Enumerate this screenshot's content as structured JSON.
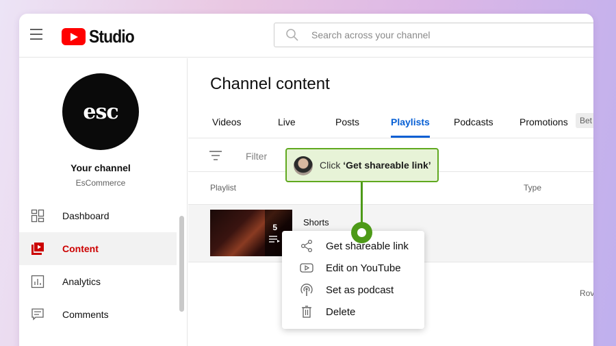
{
  "header": {
    "logo_text": "Studio",
    "search_placeholder": "Search across your channel"
  },
  "sidebar": {
    "avatar_text": "esc",
    "channel_title": "Your channel",
    "channel_handle": "EsCommerce",
    "items": [
      {
        "label": "Dashboard",
        "icon": "dashboard-icon"
      },
      {
        "label": "Content",
        "icon": "content-icon",
        "active": true
      },
      {
        "label": "Analytics",
        "icon": "analytics-icon"
      },
      {
        "label": "Comments",
        "icon": "comments-icon"
      }
    ]
  },
  "main": {
    "title": "Channel content",
    "tabs": [
      "Videos",
      "Live",
      "Posts",
      "Playlists",
      "Podcasts",
      "Promotions"
    ],
    "active_tab": "Playlists",
    "tab_badge": "Bet",
    "filter_label": "Filter",
    "columns": [
      "Playlist",
      "Type"
    ],
    "rows": [
      {
        "title": "Shorts",
        "video_count": "5"
      }
    ],
    "rows_label": "Rov"
  },
  "context_menu": {
    "items": [
      {
        "label": "Get shareable link",
        "icon": "share-icon"
      },
      {
        "label": "Edit on YouTube",
        "icon": "youtube-icon"
      },
      {
        "label": "Set as podcast",
        "icon": "podcast-icon"
      },
      {
        "label": "Delete",
        "icon": "trash-icon"
      }
    ]
  },
  "callout": {
    "prefix": "Click ",
    "emphasis": "‘Get shareable link’",
    "accent_color": "#5fa81e"
  },
  "colors": {
    "active_tab": "#065fd4",
    "active_nav": "#cc0000",
    "brand": "#ff0000"
  }
}
